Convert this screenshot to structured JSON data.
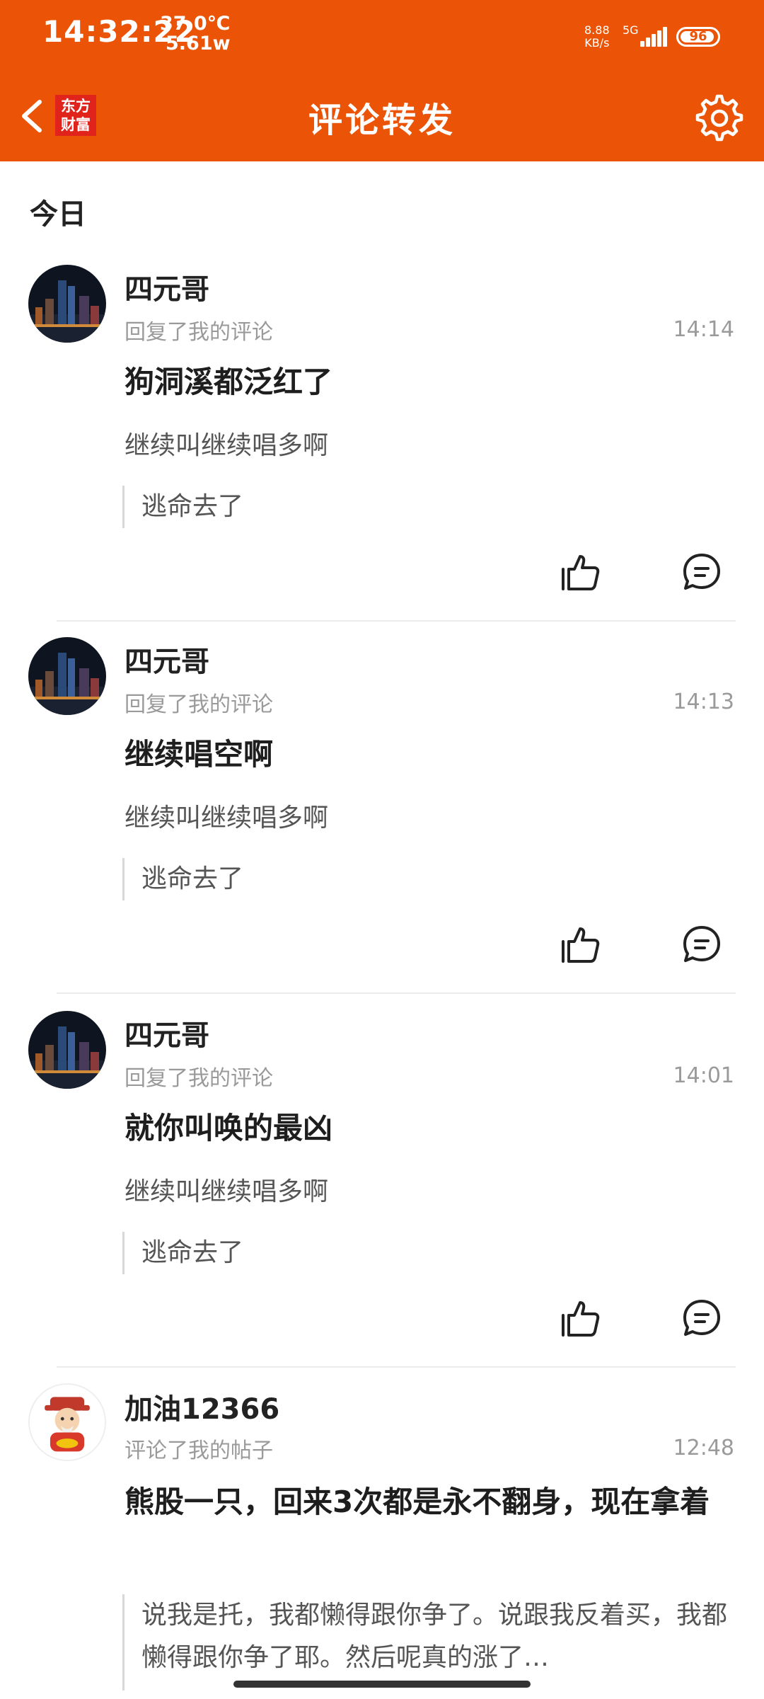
{
  "status_bar": {
    "time": "14:32:22",
    "temperature": "37.0℃",
    "power": "5.61w",
    "net_speed": "8.88",
    "net_unit": "KB/s",
    "network": "5G",
    "battery": "96"
  },
  "header": {
    "logo_line1": "东方",
    "logo_line2": "财富",
    "title": "评论转发"
  },
  "section_label": "今日",
  "colors": {
    "brand": "#EB5406",
    "logo_red": "#E0241B"
  },
  "items": [
    {
      "username": "四元哥",
      "action": "回复了我的评论",
      "time": "14:14",
      "content": "狗洞溪都泛红了",
      "target": "继续叫继续唱多啊",
      "quote": "逃命去了"
    },
    {
      "username": "四元哥",
      "action": "回复了我的评论",
      "time": "14:13",
      "content": "继续唱空啊",
      "target": "继续叫继续唱多啊",
      "quote": "逃命去了"
    },
    {
      "username": "四元哥",
      "action": "回复了我的评论",
      "time": "14:01",
      "content": "就你叫唤的最凶",
      "target": "继续叫继续唱多啊",
      "quote": "逃命去了"
    },
    {
      "username": "加油12366",
      "action": "评论了我的帖子",
      "time": "12:48",
      "content": "熊股一只，回来3次都是永不翻身，现在拿着",
      "quote": "说我是托，我都懒得跟你争了。说跟我反着买，我都懒得跟你争了耶。然后呢真的涨了…"
    }
  ]
}
